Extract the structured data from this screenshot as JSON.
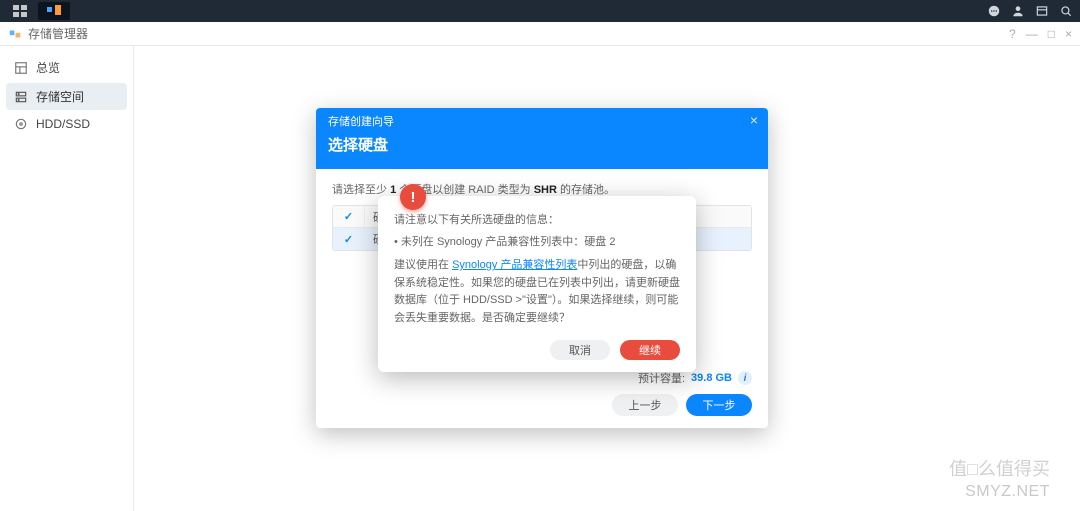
{
  "taskbar": {
    "right_icons": [
      "chat",
      "user",
      "panel",
      "search"
    ]
  },
  "app": {
    "title": "存储管理器",
    "window_controls": {
      "help": "?",
      "min": "—",
      "max": "□",
      "close": "×"
    }
  },
  "sidebar": {
    "items": [
      {
        "label": "总览",
        "icon": "dashboard"
      },
      {
        "label": "存储空间",
        "icon": "storage",
        "active": true
      },
      {
        "label": "HDD/SSD",
        "icon": "hdd"
      }
    ]
  },
  "wizard": {
    "header_title": "存储创建向导",
    "step_title": "选择硬盘",
    "instruction_pre": "请选择至少 ",
    "instruction_count": "1",
    "instruction_mid": " 个硬盘以创建 RAID 类型为 ",
    "instruction_raid": "SHR",
    "instruction_post": " 的存储池。",
    "table": {
      "header": {
        "col1": "硬盘"
      },
      "rows": [
        {
          "label": "硬盘",
          "selected": true
        }
      ]
    },
    "est_label": "预计容量:",
    "est_value": "39.8 GB",
    "btn_prev": "上一步",
    "btn_next": "下一步"
  },
  "popover": {
    "line1": "请注意以下有关所选硬盘的信息：",
    "bullet": "• 未列在 Synology 产品兼容性列表中：硬盘 2",
    "advice_pre": "建议使用在 ",
    "link": "Synology 产品兼容性列表",
    "advice_post": "中列出的硬盘，以确保系统稳定性。如果您的硬盘已在列表中列出，请更新硬盘数据库（位于 HDD/SSD >\"设置\"）。如果选择继续，则可能会丢失重要数据。是否确定要继续？",
    "btn_cancel": "取消",
    "btn_continue": "继续"
  },
  "watermark": {
    "a": "SMYZ.NET",
    "b": "值□么值得买"
  }
}
